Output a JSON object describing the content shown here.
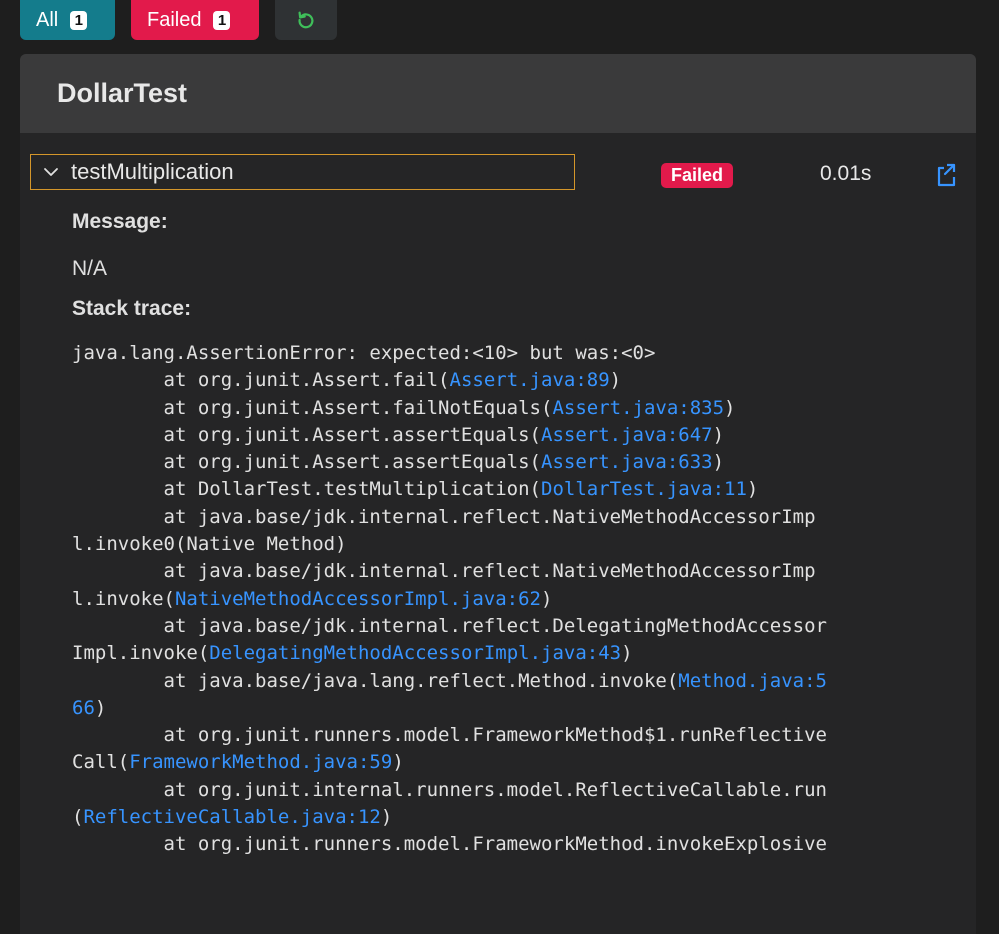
{
  "toolbar": {
    "all_label": "All",
    "all_count": "1",
    "failed_label": "Failed",
    "failed_count": "1",
    "rerun_icon": "refresh-icon"
  },
  "suite": {
    "title": "DollarTest"
  },
  "test": {
    "name": "testMultiplication",
    "status": "Failed",
    "duration": "0.01s",
    "message_label": "Message:",
    "message_value": "N/A",
    "stack_label": "Stack trace:"
  },
  "colors": {
    "accent_all": "#147c8c",
    "failed": "#e21a4b",
    "link": "#3794ff",
    "focus_border": "#d4962a"
  },
  "stack_trace": [
    [
      {
        "t": "java.lang.AssertionError: expected:<10> but was:<0>"
      }
    ],
    [
      {
        "t": "        at org.junit.Assert.fail("
      },
      {
        "t": "Assert.java:89",
        "link": true
      },
      {
        "t": ")"
      }
    ],
    [
      {
        "t": "        at org.junit.Assert.failNotEquals("
      },
      {
        "t": "Assert.java:835",
        "link": true
      },
      {
        "t": ")"
      }
    ],
    [
      {
        "t": "        at org.junit.Assert.assertEquals("
      },
      {
        "t": "Assert.java:647",
        "link": true
      },
      {
        "t": ")"
      }
    ],
    [
      {
        "t": "        at org.junit.Assert.assertEquals("
      },
      {
        "t": "Assert.java:633",
        "link": true
      },
      {
        "t": ")"
      }
    ],
    [
      {
        "t": "        at DollarTest.testMultiplication("
      },
      {
        "t": "DollarTest.java:11",
        "link": true
      },
      {
        "t": ")"
      }
    ],
    [
      {
        "t": "        at java.base/jdk.internal.reflect.NativeMethodAccessorImp"
      }
    ],
    [
      {
        "t": "l.invoke0(Native Method)"
      }
    ],
    [
      {
        "t": "        at java.base/jdk.internal.reflect.NativeMethodAccessorImp"
      }
    ],
    [
      {
        "t": "l.invoke("
      },
      {
        "t": "NativeMethodAccessorImpl.java:62",
        "link": true
      },
      {
        "t": ")"
      }
    ],
    [
      {
        "t": "        at java.base/jdk.internal.reflect.DelegatingMethodAccessor"
      }
    ],
    [
      {
        "t": "Impl.invoke("
      },
      {
        "t": "DelegatingMethodAccessorImpl.java:43",
        "link": true
      },
      {
        "t": ")"
      }
    ],
    [
      {
        "t": "        at java.base/java.lang.reflect.Method.invoke("
      },
      {
        "t": "Method.java:5",
        "link": true
      }
    ],
    [
      {
        "t": "66",
        "link": true
      },
      {
        "t": ")"
      }
    ],
    [
      {
        "t": "        at org.junit.runners.model.FrameworkMethod$1.runReflective"
      }
    ],
    [
      {
        "t": "Call("
      },
      {
        "t": "FrameworkMethod.java:59",
        "link": true
      },
      {
        "t": ")"
      }
    ],
    [
      {
        "t": "        at org.junit.internal.runners.model.ReflectiveCallable.run"
      }
    ],
    [
      {
        "t": "("
      },
      {
        "t": "ReflectiveCallable.java:12",
        "link": true
      },
      {
        "t": ")"
      }
    ],
    [
      {
        "t": "        at org.junit.runners.model.FrameworkMethod.invokeExplosive"
      }
    ]
  ]
}
